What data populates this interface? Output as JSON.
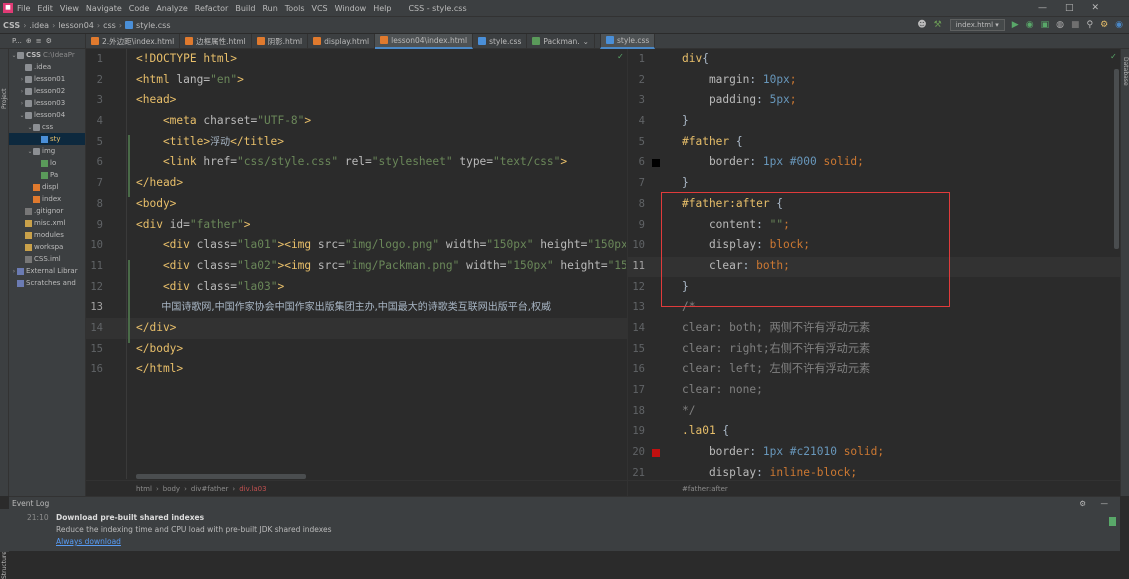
{
  "menubar": {
    "items": [
      "File",
      "Edit",
      "View",
      "Navigate",
      "Code",
      "Analyze",
      "Refactor",
      "Build",
      "Run",
      "Tools",
      "VCS",
      "Window",
      "Help"
    ],
    "title": "CSS - style.css"
  },
  "navbar": {
    "crumbs": [
      "CSS",
      ".idea",
      "lesson04",
      "css",
      "style.css"
    ],
    "run_config": "index.html"
  },
  "tabs": [
    {
      "label": "2.外边距\\index.html",
      "type": "html"
    },
    {
      "label": "边框属性.html",
      "type": "html"
    },
    {
      "label": "阴影.html",
      "type": "html"
    },
    {
      "label": "display.html",
      "type": "html"
    },
    {
      "label": "lesson04\\index.html",
      "type": "html",
      "active": true
    },
    {
      "label": "style.css",
      "type": "css"
    },
    {
      "label": "Packman.",
      "type": "img"
    },
    {
      "label": "style.css",
      "type": "css",
      "active2": true
    }
  ],
  "project": {
    "header": "P...",
    "tree": [
      {
        "label": "CSS",
        "extra": "C:\\IdeaPr",
        "icon": "folder",
        "depth": 0,
        "open": true
      },
      {
        "label": ".idea",
        "icon": "folder",
        "depth": 1,
        "open": false
      },
      {
        "label": "lesson01",
        "icon": "folder",
        "depth": 1,
        "closed": true
      },
      {
        "label": "lesson02",
        "icon": "folder",
        "depth": 1,
        "closed": true
      },
      {
        "label": "lesson03",
        "icon": "folder",
        "depth": 1,
        "closed": true
      },
      {
        "label": "lesson04",
        "icon": "folder",
        "depth": 1,
        "open": true
      },
      {
        "label": "css",
        "icon": "folder",
        "depth": 2,
        "open": true
      },
      {
        "label": "sty",
        "icon": "fcss",
        "depth": 3,
        "selected": true
      },
      {
        "label": "img",
        "icon": "folder",
        "depth": 2,
        "open": true
      },
      {
        "label": "lo",
        "icon": "fimg",
        "depth": 3
      },
      {
        "label": "Pa",
        "icon": "fimg",
        "depth": 3
      },
      {
        "label": "displ",
        "icon": "fhtml",
        "depth": 2
      },
      {
        "label": "index",
        "icon": "fhtml",
        "depth": 2
      },
      {
        "label": ".gitignor",
        "icon": "fgit",
        "depth": 1
      },
      {
        "label": "misc.xml",
        "icon": "fxml",
        "depth": 1
      },
      {
        "label": "modules",
        "icon": "fxml",
        "depth": 1
      },
      {
        "label": "workspa",
        "icon": "fxml",
        "depth": 1
      },
      {
        "label": "CSS.iml",
        "icon": "fgit",
        "depth": 1
      },
      {
        "label": "External Librar",
        "icon": "ficon",
        "depth": 0,
        "closed": true
      },
      {
        "label": "Scratches and",
        "icon": "ficon",
        "depth": 0
      }
    ]
  },
  "editor1": {
    "lines": [
      [
        {
          "t": "<!DOCTYPE html>",
          "c": "tg"
        }
      ],
      [
        {
          "t": "<html ",
          "c": "tg"
        },
        {
          "t": "lang=",
          "c": "at"
        },
        {
          "t": "\"en\"",
          "c": "av"
        },
        {
          "t": ">",
          "c": "tg"
        }
      ],
      [
        {
          "t": "<head>",
          "c": "tg"
        }
      ],
      [
        {
          "t": "    <meta ",
          "c": "tg"
        },
        {
          "t": "charset=",
          "c": "at"
        },
        {
          "t": "\"UTF-8\"",
          "c": "av"
        },
        {
          "t": ">",
          "c": "tg"
        }
      ],
      [
        {
          "t": "    <title>",
          "c": "tg"
        },
        {
          "t": "浮动",
          "c": "ch"
        },
        {
          "t": "</title>",
          "c": "tg"
        }
      ],
      [
        {
          "t": "    <link ",
          "c": "tg"
        },
        {
          "t": "href=",
          "c": "at"
        },
        {
          "t": "\"css/style.css\" ",
          "c": "av"
        },
        {
          "t": "rel=",
          "c": "at"
        },
        {
          "t": "\"stylesheet\" ",
          "c": "av"
        },
        {
          "t": "type=",
          "c": "at"
        },
        {
          "t": "\"text/css\"",
          "c": "av"
        },
        {
          "t": ">",
          "c": "tg"
        }
      ],
      [
        {
          "t": "</head>",
          "c": "tg"
        }
      ],
      [
        {
          "t": "<body>",
          "c": "tg"
        }
      ],
      [
        {
          "t": "<div ",
          "c": "tg"
        },
        {
          "t": "id=",
          "c": "at"
        },
        {
          "t": "\"father\"",
          "c": "av"
        },
        {
          "t": ">",
          "c": "tg"
        }
      ],
      [
        {
          "t": "    <div ",
          "c": "tg"
        },
        {
          "t": "class=",
          "c": "at"
        },
        {
          "t": "\"la01\"",
          "c": "av"
        },
        {
          "t": "><img ",
          "c": "tg"
        },
        {
          "t": "src=",
          "c": "at"
        },
        {
          "t": "\"img/logo.png\" ",
          "c": "av"
        },
        {
          "t": "width=",
          "c": "at"
        },
        {
          "t": "\"150px\" ",
          "c": "av"
        },
        {
          "t": "height=",
          "c": "at"
        },
        {
          "t": "\"150px\"",
          "c": "av"
        },
        {
          "t": "><",
          "c": "tg"
        }
      ],
      [
        {
          "t": "    <div ",
          "c": "tg"
        },
        {
          "t": "class=",
          "c": "at"
        },
        {
          "t": "\"la02\"",
          "c": "av"
        },
        {
          "t": "><img ",
          "c": "tg"
        },
        {
          "t": "src=",
          "c": "at"
        },
        {
          "t": "\"img/Packman.png\" ",
          "c": "av"
        },
        {
          "t": "width=",
          "c": "at"
        },
        {
          "t": "\"150px\" ",
          "c": "av"
        },
        {
          "t": "height=",
          "c": "at"
        },
        {
          "t": "\"150px",
          "c": "av"
        }
      ],
      [
        {
          "t": "    <div ",
          "c": "tg"
        },
        {
          "t": "class=",
          "c": "at"
        },
        {
          "t": "\"la03\"",
          "c": "av"
        },
        {
          "t": ">",
          "c": "tg"
        }
      ],
      [
        {
          "t": "        中国诗歌网,中国作家协会中国作家出版集团主办,中国最大的诗歌类互联网出版平台,权威",
          "c": "ch"
        }
      ],
      [
        {
          "t": "</div>",
          "c": "tg"
        }
      ],
      [
        {
          "t": "</body>",
          "c": "tg"
        }
      ],
      [
        {
          "t": "</html>",
          "c": "tg"
        }
      ]
    ],
    "current_line": 13,
    "breadcrumb": [
      "html",
      "body",
      "div#father",
      "div.la03"
    ]
  },
  "editor2": {
    "lines": [
      [
        {
          "t": "div",
          "c": "sel"
        },
        {
          "t": "{",
          "c": "pl"
        }
      ],
      [
        {
          "t": "    margin",
          "c": "prop"
        },
        {
          "t": ": ",
          "c": "pl"
        },
        {
          "t": "10px",
          "c": "num"
        },
        {
          "t": ";",
          "c": "kw"
        }
      ],
      [
        {
          "t": "    padding",
          "c": "prop"
        },
        {
          "t": ": ",
          "c": "pl"
        },
        {
          "t": "5px",
          "c": "num"
        },
        {
          "t": ";",
          "c": "kw"
        }
      ],
      [
        {
          "t": "}",
          "c": "pl"
        }
      ],
      [
        {
          "t": "#father ",
          "c": "sel"
        },
        {
          "t": "{",
          "c": "pl"
        }
      ],
      [
        {
          "t": "    border",
          "c": "prop"
        },
        {
          "t": ": ",
          "c": "pl"
        },
        {
          "t": "1px ",
          "c": "num"
        },
        {
          "t": "#000 ",
          "c": "num"
        },
        {
          "t": "solid",
          "c": "kw"
        },
        {
          "t": ";",
          "c": "kw"
        }
      ],
      [
        {
          "t": "}",
          "c": "pl"
        }
      ],
      [
        {
          "t": "#father:after ",
          "c": "sel"
        },
        {
          "t": "{",
          "c": "pl"
        }
      ],
      [
        {
          "t": "    content",
          "c": "prop"
        },
        {
          "t": ": ",
          "c": "pl"
        },
        {
          "t": "\"\"",
          "c": "av"
        },
        {
          "t": ";",
          "c": "kw"
        }
      ],
      [
        {
          "t": "    display",
          "c": "prop"
        },
        {
          "t": ": ",
          "c": "pl"
        },
        {
          "t": "block",
          "c": "kw"
        },
        {
          "t": ";",
          "c": "kw"
        }
      ],
      [
        {
          "t": "    clear",
          "c": "prop"
        },
        {
          "t": ": ",
          "c": "pl"
        },
        {
          "t": "both",
          "c": "kw"
        },
        {
          "t": ";",
          "c": "kw"
        }
      ],
      [
        {
          "t": "}",
          "c": "pl"
        }
      ],
      [
        {
          "t": "/*",
          "c": "cm"
        }
      ],
      [
        {
          "t": "clear: both; 两侧不许有浮动元素",
          "c": "cm"
        }
      ],
      [
        {
          "t": "clear: right;右侧不许有浮动元素",
          "c": "cm"
        }
      ],
      [
        {
          "t": "clear: left; 左侧不许有浮动元素",
          "c": "cm"
        }
      ],
      [
        {
          "t": "clear: none;",
          "c": "cm"
        }
      ],
      [
        {
          "t": "*/",
          "c": "cm"
        }
      ],
      [
        {
          "t": ".la01 ",
          "c": "sel"
        },
        {
          "t": "{",
          "c": "pl"
        }
      ],
      [
        {
          "t": "    border",
          "c": "prop"
        },
        {
          "t": ": ",
          "c": "pl"
        },
        {
          "t": "1px ",
          "c": "num"
        },
        {
          "t": "#c21010 ",
          "c": "num"
        },
        {
          "t": "solid",
          "c": "kw"
        },
        {
          "t": ";",
          "c": "kw"
        }
      ],
      [
        {
          "t": "    display",
          "c": "prop"
        },
        {
          "t": ": ",
          "c": "pl"
        },
        {
          "t": "inline-block",
          "c": "kw"
        },
        {
          "t": ";",
          "c": "kw"
        }
      ]
    ],
    "current_line": 11,
    "breadcrumb": "#father:after",
    "swatches": {
      "6": "#000000",
      "20": "#c21010"
    }
  },
  "eventlog": {
    "title": "Event Log",
    "time": "21:10",
    "headline": "Download pre-built shared indexes",
    "body": "Reduce the indexing time and CPU load with pre-built JDK shared indexes",
    "link": "Always download"
  },
  "strips": {
    "left_project": "Project",
    "left_structure": "Structure",
    "right_database": "Database"
  }
}
